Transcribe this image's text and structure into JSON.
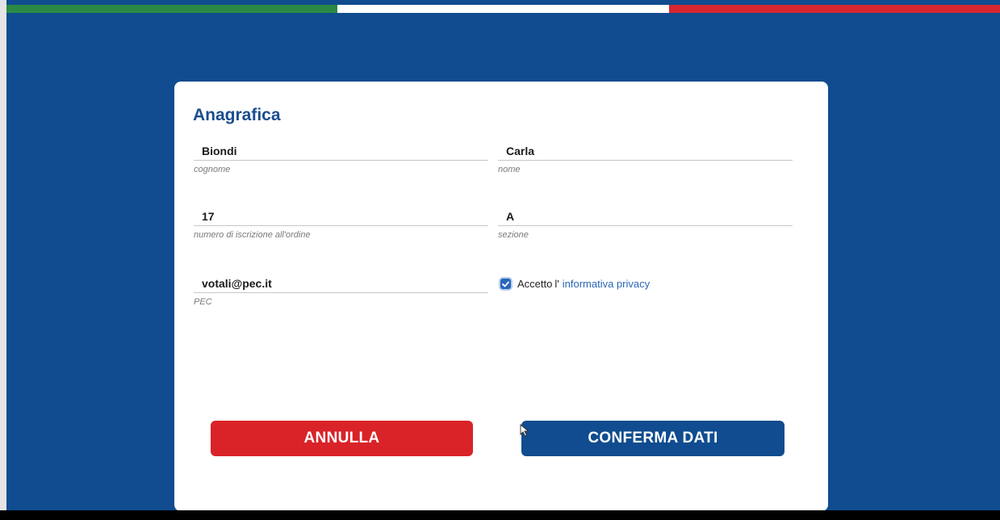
{
  "form": {
    "title": "Anagrafica",
    "cognome": {
      "value": "Biondi",
      "label": "cognome"
    },
    "nome": {
      "value": "Carla",
      "label": "nome"
    },
    "numero": {
      "value": "17",
      "label": "numero di iscrizione all'ordine"
    },
    "sezione": {
      "value": "A",
      "label": "sezione"
    },
    "pec": {
      "value": "votali@pec.it",
      "label": "PEC"
    },
    "privacy": {
      "checked": true,
      "prefix": "Accetto",
      "middle": "l'",
      "link_text": "informativa privacy"
    }
  },
  "buttons": {
    "cancel": "ANNULLA",
    "confirm": "CONFERMA DATI"
  },
  "colors": {
    "background": "#104c8f",
    "cancel": "#d92328",
    "confirm": "#104c8f",
    "title": "#1a4d8e",
    "link": "#2a66b8"
  },
  "icons": {
    "checkbox": "checkmark-icon",
    "cursor": "mouse-pointer-icon"
  }
}
